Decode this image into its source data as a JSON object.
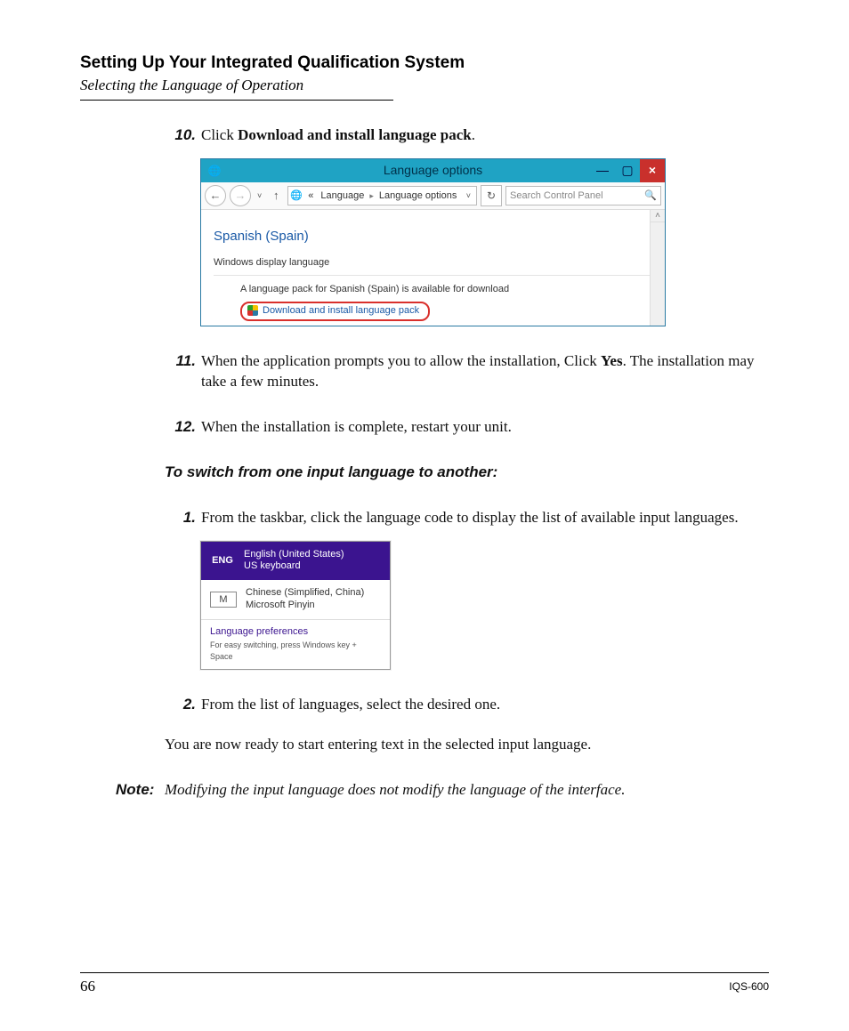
{
  "header": {
    "chapter": "Setting Up Your Integrated Qualification System",
    "section": "Selecting the Language of Operation"
  },
  "steps": {
    "s10": {
      "num": "10.",
      "lead": "Click ",
      "bold": "Download and install language pack",
      "tail": "."
    },
    "s11": {
      "num": "11.",
      "lead": "When the application prompts you to allow the installation, Click ",
      "bold": "Yes",
      "tail": ". The installation may take a few minutes."
    },
    "s12": {
      "num": "12.",
      "text": "When the installation is complete, restart your unit."
    }
  },
  "subhead": "To switch from one input language to another:",
  "substeps": {
    "s1": {
      "num": "1.",
      "text": "From the taskbar, click the language code to display the list of available input languages."
    },
    "s2": {
      "num": "2.",
      "text": "From the list of languages, select the desired one."
    }
  },
  "closing": "You are now ready to start entering text in the selected input language.",
  "note": {
    "label": "Note:",
    "text": "Modifying the input language does not modify the language of the interface."
  },
  "footer": {
    "page": "66",
    "model": "IQS-600"
  },
  "shot1": {
    "title": "Language options",
    "breadcrumb": {
      "sep": "«",
      "seg1": "Language",
      "seg2": "Language options"
    },
    "search_placeholder": "Search Control Panel",
    "language": "Spanish (Spain)",
    "wdl": "Windows display language",
    "avail": "A language pack for Spanish (Spain) is available for download",
    "download": "Download and install language pack",
    "min": "—",
    "max": "▢",
    "close": "×",
    "back": "←",
    "fwd": "→",
    "up": "↑",
    "refresh": "↻",
    "search_icon": "🔍",
    "drop": "˅",
    "tri": "▸",
    "scroll_up": "˄"
  },
  "shot2": {
    "code1": "ENG",
    "name1": "English (United States)",
    "kb1": "US keyboard",
    "code2": "M",
    "name2": "Chinese (Simplified, China)",
    "kb2": "Microsoft Pinyin",
    "pref": "Language preferences",
    "hint": "For easy switching, press Windows key + Space"
  }
}
